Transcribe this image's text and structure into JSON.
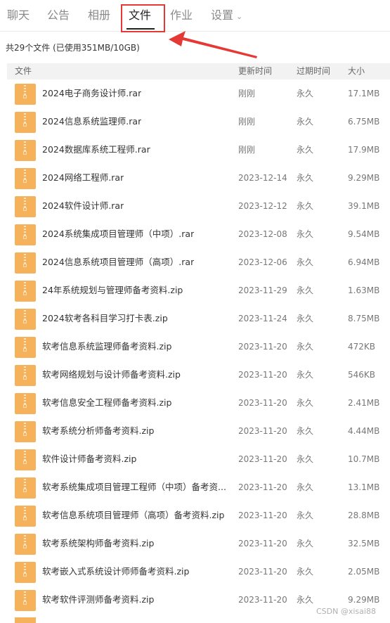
{
  "tabs": [
    "聊天",
    "公告",
    "相册",
    "文件",
    "作业",
    "设置"
  ],
  "summary": "共29个文件 (已使用351MB/10GB)",
  "columns": {
    "name": "文件",
    "updated": "更新时间",
    "expiry": "过期时间",
    "size": "大小"
  },
  "files": [
    {
      "name": "2024电子商务设计师.rar",
      "updated": "刚刚",
      "expiry": "永久",
      "size": "17.1MB"
    },
    {
      "name": "2024信息系统监理师.rar",
      "updated": "刚刚",
      "expiry": "永久",
      "size": "6.75MB"
    },
    {
      "name": "2024数据库系统工程师.rar",
      "updated": "刚刚",
      "expiry": "永久",
      "size": "17.9MB"
    },
    {
      "name": "2024网络工程师.rar",
      "updated": "2023-12-14",
      "expiry": "永久",
      "size": "9.29MB"
    },
    {
      "name": "2024软件设计师.rar",
      "updated": "2023-12-12",
      "expiry": "永久",
      "size": "39.1MB"
    },
    {
      "name": "2024系统集成项目管理师（中项）.rar",
      "updated": "2023-12-08",
      "expiry": "永久",
      "size": "9.54MB"
    },
    {
      "name": "2024信息系统项目管理师（高项）.rar",
      "updated": "2023-12-06",
      "expiry": "永久",
      "size": "6.94MB"
    },
    {
      "name": "24年系统规划与管理师备考资料.zip",
      "updated": "2023-11-29",
      "expiry": "永久",
      "size": "1.63MB"
    },
    {
      "name": "2024软考各科目学习打卡表.zip",
      "updated": "2023-11-24",
      "expiry": "永久",
      "size": "8.75MB"
    },
    {
      "name": "软考信息系统监理师备考资料.zip",
      "updated": "2023-11-20",
      "expiry": "永久",
      "size": "472KB"
    },
    {
      "name": "软考网络规划与设计师备考资料.zip",
      "updated": "2023-11-20",
      "expiry": "永久",
      "size": "546KB"
    },
    {
      "name": "软考信息安全工程师备考资料.zip",
      "updated": "2023-11-20",
      "expiry": "永久",
      "size": "2.41MB"
    },
    {
      "name": "软考系统分析师备考资料.zip",
      "updated": "2023-11-20",
      "expiry": "永久",
      "size": "4.44MB"
    },
    {
      "name": "软件设计师备考资料.zip",
      "updated": "2023-11-20",
      "expiry": "永久",
      "size": "10.7MB"
    },
    {
      "name": "软考系统集成项目管理工程师（中项）备考资...",
      "updated": "2023-11-20",
      "expiry": "永久",
      "size": "13.1MB"
    },
    {
      "name": "软考信息系统项目管理师（高项）备考资料.zip",
      "updated": "2023-11-20",
      "expiry": "永久",
      "size": "28.8MB"
    },
    {
      "name": "软考系统架构师备考资料.zip",
      "updated": "2023-11-20",
      "expiry": "永久",
      "size": "32.5MB"
    },
    {
      "name": "软考嵌入式系统设计师师备考资料.zip",
      "updated": "2023-11-20",
      "expiry": "永久",
      "size": "2.05MB"
    },
    {
      "name": "软考软件评测师备考资料.zip",
      "updated": "2023-11-20",
      "expiry": "永久",
      "size": "9.29MB"
    }
  ],
  "watermark": "CSDN @xisai88",
  "colors": {
    "folder": "#f6b15b",
    "highlight": "#e53935",
    "header_bg": "#f2f2f2"
  },
  "icons": {
    "file": "zip-file-icon",
    "dropdown": "chevron-down-icon",
    "annotation": "red-arrow-icon"
  }
}
